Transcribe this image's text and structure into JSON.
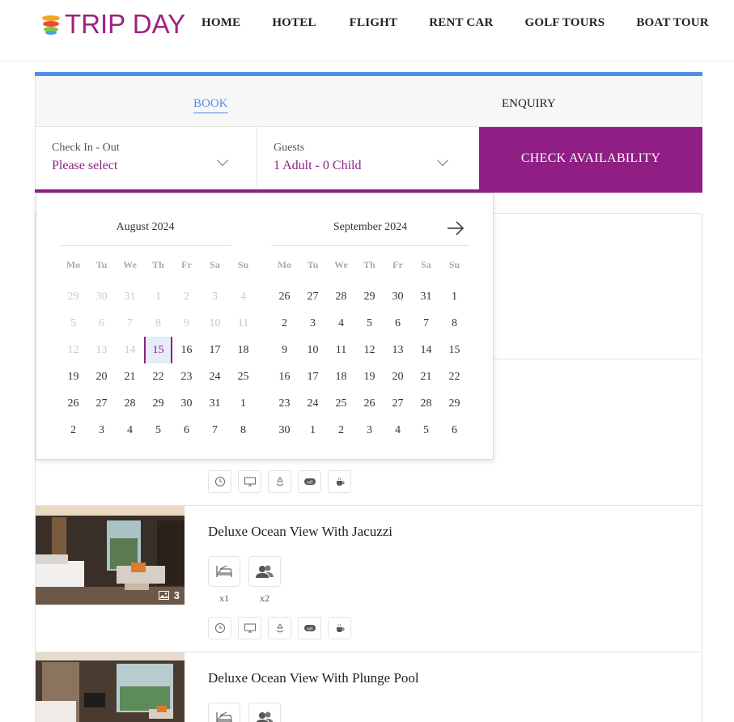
{
  "brand": {
    "name": "TRIP DAY"
  },
  "nav": [
    "HOME",
    "HOTEL",
    "FLIGHT",
    "RENT CAR",
    "GOLF TOURS",
    "BOAT TOUR"
  ],
  "tabs": {
    "book": "BOOK",
    "enquiry": "ENQUIRY"
  },
  "form": {
    "checkin_label": "Check In - Out",
    "checkin_value": "Please select",
    "guests_label": "Guests",
    "guests_value": "1 Adult - 0 Child",
    "check_button": "CHECK AVAILABILITY"
  },
  "calendar": {
    "weekdays": [
      "Mo",
      "Tu",
      "We",
      "Th",
      "Fr",
      "Sa",
      "Su"
    ],
    "months": [
      {
        "title": "August 2024",
        "weeks": [
          [
            "29",
            "30",
            "31",
            "1",
            "2",
            "3",
            "4"
          ],
          [
            "5",
            "6",
            "7",
            "8",
            "9",
            "10",
            "11"
          ],
          [
            "12",
            "13",
            "14",
            "15",
            "16",
            "17",
            "18"
          ],
          [
            "19",
            "20",
            "21",
            "22",
            "23",
            "24",
            "25"
          ],
          [
            "26",
            "27",
            "28",
            "29",
            "30",
            "31",
            "1"
          ],
          [
            "2",
            "3",
            "4",
            "5",
            "6",
            "7",
            "8"
          ]
        ],
        "disabled_count": 17,
        "today_index": 17
      },
      {
        "title": "September 2024",
        "weeks": [
          [
            "26",
            "27",
            "28",
            "29",
            "30",
            "31",
            "1"
          ],
          [
            "2",
            "3",
            "4",
            "5",
            "6",
            "7",
            "8"
          ],
          [
            "9",
            "10",
            "11",
            "12",
            "13",
            "14",
            "15"
          ],
          [
            "16",
            "17",
            "18",
            "19",
            "20",
            "21",
            "22"
          ],
          [
            "23",
            "24",
            "25",
            "26",
            "27",
            "28",
            "29"
          ],
          [
            "30",
            "1",
            "2",
            "3",
            "4",
            "5",
            "6"
          ]
        ],
        "disabled_count": 0,
        "today_index": -1
      }
    ]
  },
  "rooms": [
    {
      "title": "",
      "photos": "",
      "beds": "",
      "guests": ""
    },
    {
      "title": "",
      "photos": "",
      "beds": "",
      "guests": ""
    },
    {
      "title": "Deluxe Ocean View With Jacuzzi",
      "photos": "3",
      "beds": "x1",
      "guests": "x2"
    },
    {
      "title": "Deluxe Ocean View With Plunge Pool",
      "photos": "",
      "beds": "",
      "guests": ""
    }
  ],
  "amenity_icons": [
    "clock-icon",
    "tv-icon",
    "recycle-icon",
    "wifi-icon",
    "coffee-icon"
  ],
  "colors": {
    "brand": "#8f1f84",
    "accent": "#4f8ee4"
  }
}
